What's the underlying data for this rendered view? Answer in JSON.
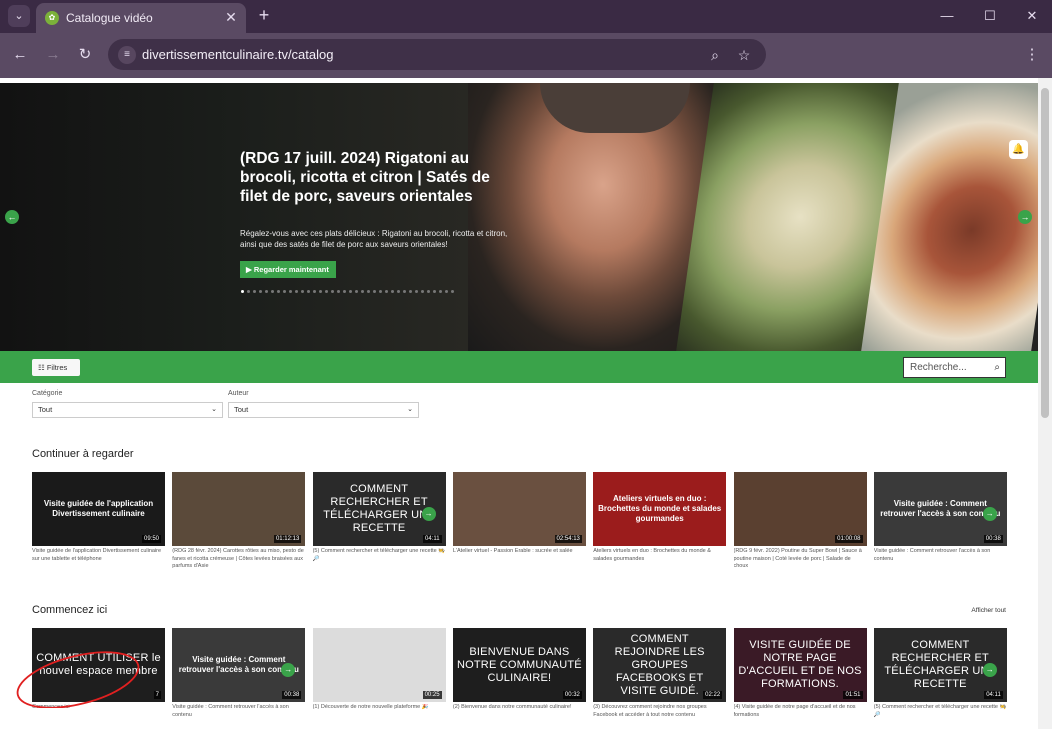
{
  "browser": {
    "tab_title": "Catalogue vidéo",
    "url": "divertissementculinaire.tv/catalog"
  },
  "hero": {
    "title": "(RDG 17 juill. 2024) Rigatoni au brocoli, ricotta et citron | Satés de filet de porc, saveurs orientales",
    "description": "Régalez-vous avec ces plats délicieux : Rigatoni au brocoli, ricotta et citron, ainsi que des satés de filet de porc aux saveurs orientales!",
    "cta_label": "Regarder maintenant",
    "slide_count": 36,
    "active_slide": 1
  },
  "filters": {
    "button_label": "Filtres",
    "search_placeholder": "Recherche...",
    "category_label": "Catégorie",
    "category_value": "Tout",
    "author_label": "Auteur",
    "author_value": "Tout"
  },
  "continue_watching": {
    "title": "Continuer à regarder",
    "items": [
      {
        "thumb_text": "Visite guidée de l'application Divertissement culinaire",
        "duration": "09:50",
        "caption": "Visite guidée de l'application Divertissement culinaire sur une tablette et téléphone",
        "bg": "#1a1a1a"
      },
      {
        "thumb_text": "",
        "duration": "01:12:13",
        "caption": "(RDG 28 févr. 2024) Carottes rôties au miso, pesto de fanes et ricotta crémeuse | Côtes levées braisées aux parfums d'Asie",
        "bg": "#5b4a3a"
      },
      {
        "thumb_text": "COMMENT RECHERCHER ET TÉLÉCHARGER UNE RECETTE",
        "duration": "04:11",
        "caption": "(5) Comment rechercher et télécharger une recette 🧑‍🍳🔎",
        "bg": "#2a2a2a"
      },
      {
        "thumb_text": "",
        "duration": "02:54:13",
        "caption": "L'Atelier virtuel - Passion Erable : sucrée et salée",
        "bg": "#6a5040"
      },
      {
        "thumb_text": "Ateliers virtuels en duo : Brochettes du monde et salades gourmandes",
        "duration": "",
        "caption": "Ateliers virtuels en duo : Brochettes du monde & salades gourmandes",
        "bg": "#9b1c1c"
      },
      {
        "thumb_text": "",
        "duration": "01:00:08",
        "caption": "(RDG 9 févr. 2022) Poutine du Super Bowl | Sauce à poutine maison | Coté levée de porc | Salade de choux",
        "bg": "#5a4030"
      },
      {
        "thumb_text": "Visite guidée : Comment retrouver l'accès à son contenu",
        "duration": "00:38",
        "caption": "Visite guidée : Comment retrouver l'accès à son contenu",
        "bg": "#3a3a3a"
      }
    ]
  },
  "start_here": {
    "title": "Commencez ici",
    "see_all": "Afficher tout",
    "items": [
      {
        "thumb_text": "COMMENT UTILISER le nouvel espace membre",
        "duration": "7",
        "caption": "Commencez ici",
        "bg": "#1e1e1e"
      },
      {
        "thumb_text": "Visite guidée : Comment retrouver l'accès à son contenu",
        "duration": "00:38",
        "caption": "Visite guidée : Comment retrouver l'accès à son contenu",
        "bg": "#3a3a3a"
      },
      {
        "thumb_text": "",
        "duration": "00:25",
        "caption": "(1) Découverte de notre nouvelle plateforme 🎉",
        "bg": "#dcdcdc"
      },
      {
        "thumb_text": "BIENVENUE DANS NOTRE COMMUNAUTÉ CULINAIRE!",
        "duration": "00:32",
        "caption": "(2) Bienvenue dans notre communauté culinaire!",
        "bg": "#1e1e1e"
      },
      {
        "thumb_text": "COMMENT REJOINDRE LES GROUPES FACEBOOKS ET VISITE GUIDÉ.",
        "duration": "02:22",
        "caption": "(3) Découvrez comment rejoindre nos groupes Facebook et accéder à tout notre contenu",
        "bg": "#2a2a2a"
      },
      {
        "thumb_text": "VISITE GUIDÉE DE NOTRE PAGE D'ACCUEIL ET DE NOS FORMATIONS.",
        "duration": "01:51",
        "caption": "(4) Visite guidée de notre page d'accueil et de nos formations",
        "bg": "#3a1a26"
      },
      {
        "thumb_text": "COMMENT RECHERCHER ET TÉLÉCHARGER UNE RECETTE",
        "duration": "04:11",
        "caption": "(5) Comment rechercher et télécharger une recette 🧑‍🍳🔎",
        "bg": "#2a2a2a"
      }
    ]
  },
  "colors": {
    "brand_green": "#3aa34a",
    "annotation_red": "#e02020"
  }
}
